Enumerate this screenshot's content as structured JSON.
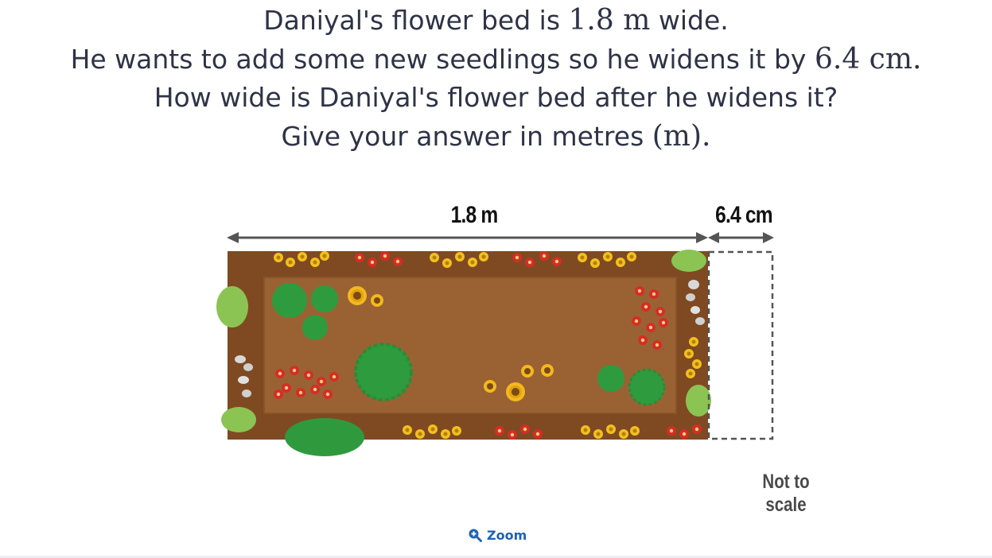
{
  "question": {
    "line1_a": "Daniyal's flower bed is ",
    "line1_math": "1.8 m",
    "line1_b": " wide.",
    "line2_a": "He wants to add some new seedlings so he widens it by ",
    "line2_math": "6.4 cm",
    "line2_b": ".",
    "line3": "How wide is Daniyal's flower bed after he widens it?",
    "line4_a": "Give your answer in metres ",
    "line4_math": "(m)",
    "line4_b": "."
  },
  "figure": {
    "bed_width_label": "1.8 m",
    "extension_label": "6.4 cm",
    "note": "Not to scale"
  },
  "zoom": {
    "label": "Zoom",
    "icon": "zoom-in-icon"
  },
  "colors": {
    "text": "#2e3346",
    "soil": "#8a5429",
    "soil_inner": "#9a6233",
    "accent": "#1f62b5"
  }
}
